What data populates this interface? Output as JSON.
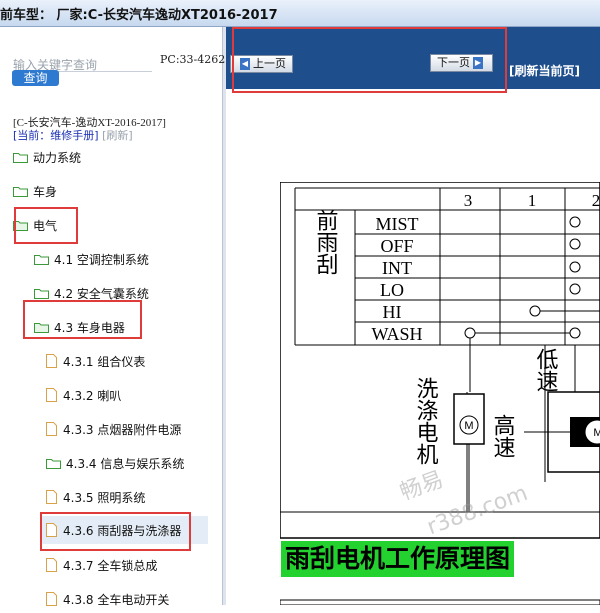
{
  "title": "前车型：  厂家:C-长安汽车逸动XT2016-2017",
  "search": {
    "placeholder": "输入关键字查询",
    "button": "查询"
  },
  "pc_label": "PC:33-4262",
  "car_title": "[C-长安汽车-逸动XT-2016-2017]",
  "current": {
    "prefix": "[当前：维修手册]",
    "refresh": "[刷新]"
  },
  "tree": [
    {
      "label": "动力系统"
    },
    {
      "label": "车身"
    },
    {
      "label": "电气"
    },
    {
      "label": "4.1 空调控制系统"
    },
    {
      "label": "4.2 安全气囊系统"
    },
    {
      "label": "4.3 车身电器"
    },
    {
      "label": "4.3.1 组合仪表"
    },
    {
      "label": "4.3.2 喇叭"
    },
    {
      "label": "4.3.3 点烟器附件电源"
    },
    {
      "label": "4.3.4 信息与娱乐系统"
    },
    {
      "label": "4.3.5 照明系统"
    },
    {
      "label": "4.3.6 雨刮器与洗涤器"
    },
    {
      "label": "4.3.7 全车锁总成"
    },
    {
      "label": "4.3.8 全车电动开关"
    }
  ],
  "toolbar": {
    "prev": "上一页",
    "next": "下一页",
    "refresh": "[刷新当前页]"
  },
  "doc": {
    "cols": [
      "3",
      "1",
      "2"
    ],
    "group_label": "前雨刮",
    "rows": [
      "MIST",
      "OFF",
      "INT",
      "LO",
      "HI",
      "WASH"
    ],
    "washer_motor": "洗涤电机",
    "high_speed": "高速",
    "low_speed": "低速",
    "motor_symbol": "M",
    "caption": "雨刮电机工作原理图"
  },
  "watermark": {
    "line1": "畅易",
    "line2": "r388.com"
  },
  "colors": {
    "toolbar": "#1e4e8c",
    "highlight_box": "#e03b3b",
    "caption_bg": "#23d12f",
    "query_button": "#2f7ad1"
  }
}
